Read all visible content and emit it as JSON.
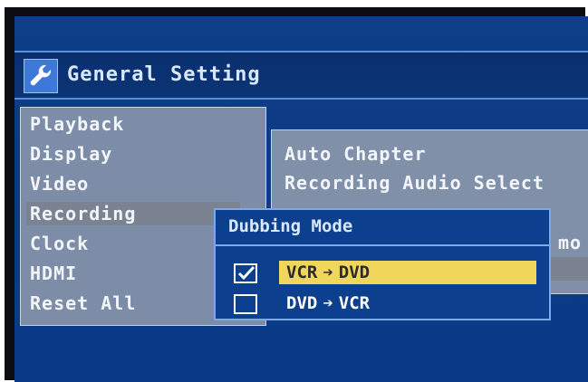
{
  "header": {
    "title": "General Setting",
    "icon": "wrench-icon"
  },
  "left_menu": {
    "items": [
      {
        "label": "Playback"
      },
      {
        "label": "Display"
      },
      {
        "label": "Video"
      },
      {
        "label": "Recording"
      },
      {
        "label": "Clock"
      },
      {
        "label": "HDMI"
      },
      {
        "label": "Reset All"
      }
    ],
    "selected_index": 3
  },
  "right_panel": {
    "items": [
      {
        "label": "Auto Chapter"
      },
      {
        "label": "Recording Audio Select"
      },
      {
        "label": "mo"
      }
    ]
  },
  "dubbing_popup": {
    "title": "Dubbing Mode",
    "options": [
      {
        "from": "VCR",
        "arrow": "➔",
        "to": "DVD",
        "checked": true,
        "selected": true
      },
      {
        "from": "DVD",
        "arrow": "➔",
        "to": "VCR",
        "checked": false,
        "selected": false
      }
    ]
  },
  "colors": {
    "screen_blue": "#0c3a86",
    "highlight_yellow": "#f0d65a",
    "menu_grey": "#96a0af"
  }
}
